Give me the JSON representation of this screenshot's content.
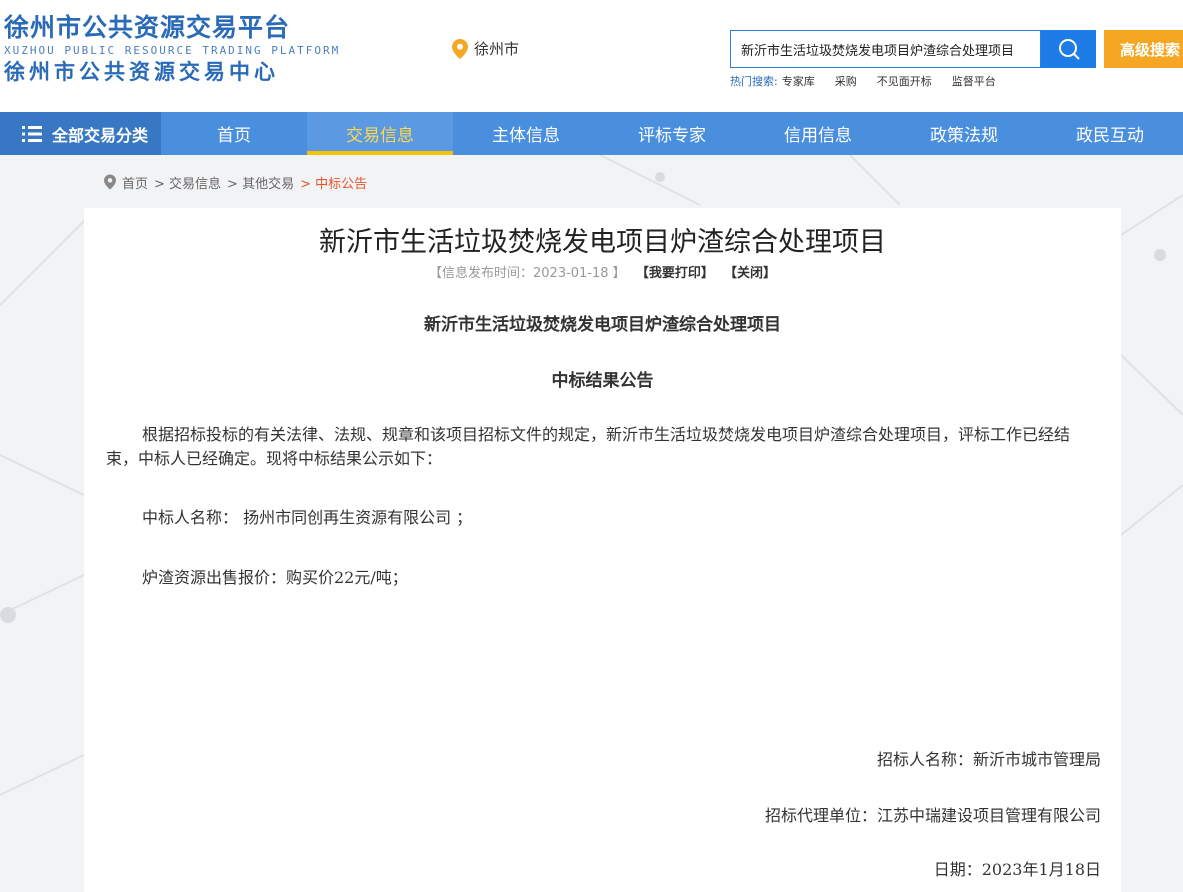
{
  "header": {
    "logo_title": "徐州市公共资源交易平台",
    "logo_en": "XUZHOU PUBLIC RESOURCE TRADING PLATFORM",
    "logo_sub": "徐州市公共资源交易中心",
    "location": "徐州市",
    "search_value": "新沂市生活垃圾焚烧发电项目炉渣综合处理项目",
    "advanced_search": "高级搜索",
    "hot_label": "热门搜索:",
    "hot_items": [
      "专家库",
      "采购",
      "不见面开标",
      "监督平台"
    ]
  },
  "nav": {
    "all_categories": "全部交易分类",
    "items": [
      "首页",
      "交易信息",
      "主体信息",
      "评标专家",
      "信用信息",
      "政策法规",
      "政民互动"
    ],
    "active_index": 1
  },
  "breadcrumb": {
    "items": [
      "首页",
      "> 交易信息",
      "> 其他交易",
      "> 中标公告"
    ]
  },
  "article": {
    "title": "新沂市生活垃圾焚烧发电项目炉渣综合处理项目",
    "meta_date": "【信息发布时间：2023-01-18 】",
    "print": "【我要打印】",
    "close": "【关闭】",
    "doc_heading": "新沂市生活垃圾焚烧发电项目炉渣综合处理项目",
    "doc_subheading": "中标结果公告",
    "paragraph": "根据招标投标的有关法律、法规、规章和该项目招标文件的规定，新沂市生活垃圾焚烧发电项目炉渣综合处理项目，评标工作已经结束，中标人已经确定。现将中标结果公示如下：",
    "winner": "中标人名称：  扬州市同创再生资源有限公司 ；",
    "price": "炉渣资源出售报价：购买价22元/吨；",
    "tenderer": "招标人名称：新沂市城市管理局",
    "agency": "招标代理单位：江苏中瑞建设项目管理有限公司",
    "date": "日期：2023年1月18日"
  },
  "colors": {
    "brand_blue": "#2a6bb8",
    "nav_blue": "#4a8fde",
    "accent_orange": "#f5a623",
    "active_yellow": "#ffd84c",
    "breadcrumb_current": "#e8542e"
  },
  "icons": [
    "location-pin-icon",
    "search-icon",
    "menu-icon"
  ]
}
